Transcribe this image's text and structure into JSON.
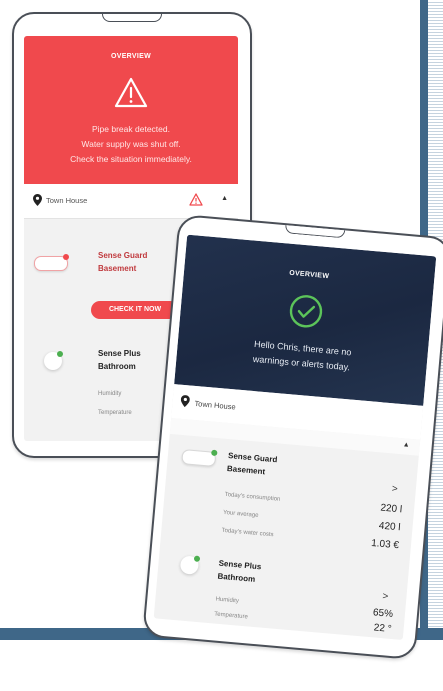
{
  "phone_alert": {
    "header": "OVERVIEW",
    "message_lines": [
      "Pipe break detected.",
      "Water supply was shut off.",
      "Check the situation immediately."
    ],
    "location": "Town House",
    "device1": {
      "name": "Sense Guard",
      "room": "Basement"
    },
    "check_button": "CHECK IT NOW",
    "device2": {
      "name": "Sense Plus",
      "room": "Bathroom"
    },
    "labels": [
      "Humidity",
      "Temperature"
    ]
  },
  "phone_ok": {
    "header": "OVERVIEW",
    "message_lines": [
      "Hello Chris, there are no",
      "warnings or alerts today."
    ],
    "location": "Town House",
    "device1": {
      "name": "Sense Guard",
      "room": "Basement",
      "rows": [
        {
          "label": "Today's consumption",
          "value": "220 l"
        },
        {
          "label": "Your average",
          "value": "420 l"
        },
        {
          "label": "Today's water costs",
          "value": "1.03 €"
        }
      ]
    },
    "device2": {
      "name": "Sense Plus",
      "room": "Bathroom",
      "rows": [
        {
          "label": "Humidity",
          "value": "65%"
        },
        {
          "label": "Temperature",
          "value": "22 °"
        }
      ]
    }
  },
  "colors": {
    "alert_red": "#f0494d",
    "ok_green": "#5cc45a",
    "navy": "#1d2b45",
    "frame_blue": "#3f6788"
  }
}
